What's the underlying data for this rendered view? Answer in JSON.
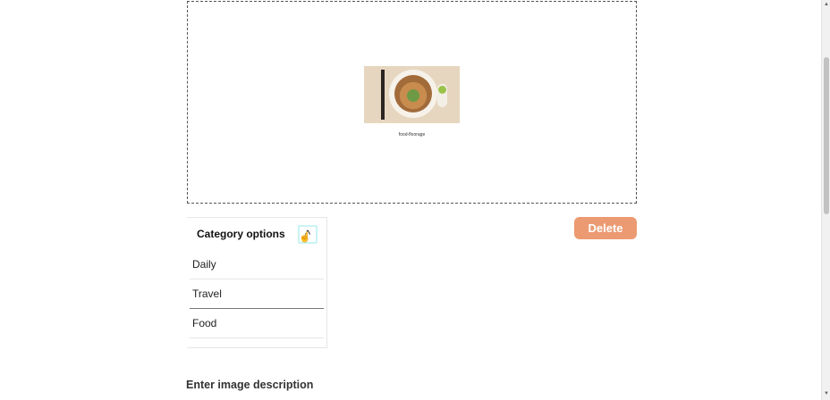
{
  "preview": {
    "caption": "food-floorage"
  },
  "category": {
    "title": "Category options",
    "items": [
      "Daily",
      "Travel",
      "Food"
    ],
    "active_index": 1
  },
  "actions": {
    "delete_label": "Delete"
  },
  "description": {
    "label": "Enter image description"
  },
  "icons": {
    "toggle": "chevron-up-icon",
    "cursor": "hand-cursor-icon"
  },
  "colors": {
    "delete_bg": "#ec9a72",
    "toggle_focus": "#c9f3f4"
  }
}
